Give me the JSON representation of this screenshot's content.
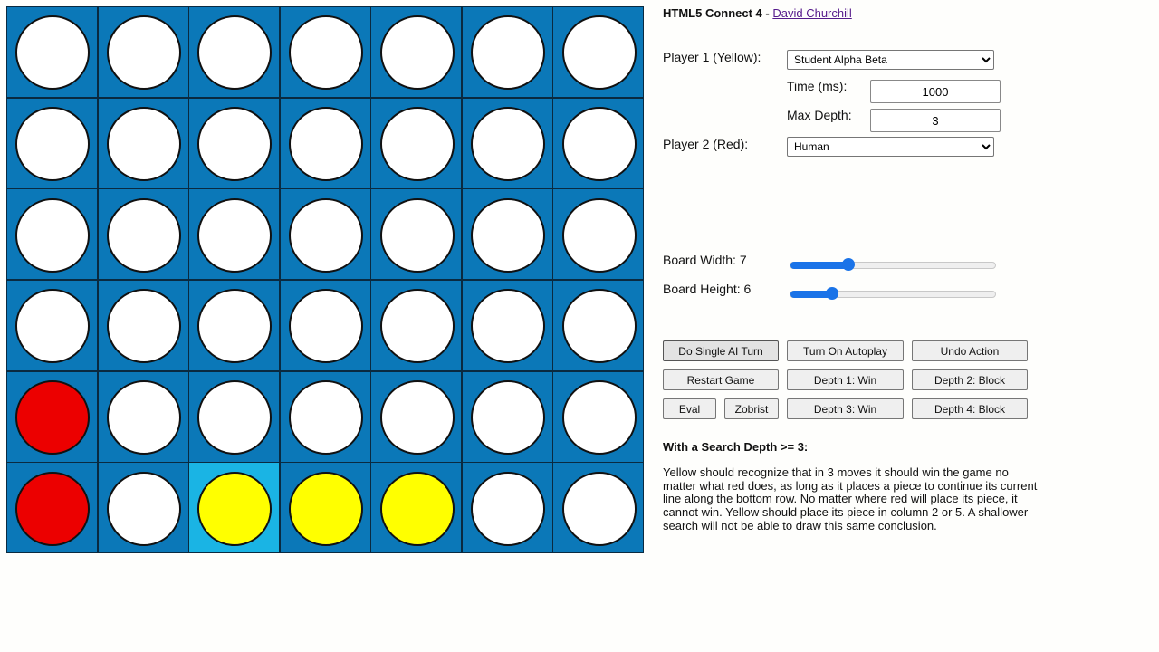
{
  "header": {
    "title": "HTML5 Connect 4",
    "separator": " - ",
    "author_link": "David Churchill"
  },
  "players": {
    "player1_label": "Player 1 (Yellow):",
    "player1_selected": "Student Alpha Beta",
    "time_label": "Time (ms):",
    "time_value": "1000",
    "depth_label": "Max Depth:",
    "depth_value": "3",
    "player2_label": "Player 2 (Red):",
    "player2_selected": "Human"
  },
  "board_settings": {
    "width_label": "Board Width: 7",
    "width_value": 7,
    "width_fraction": 0.28,
    "height_label": "Board Height: 6",
    "height_value": 6,
    "height_fraction": 0.2
  },
  "buttons": {
    "single_ai_turn": "Do Single AI Turn",
    "autoplay": "Turn On Autoplay",
    "undo": "Undo Action",
    "restart": "Restart Game",
    "depth1": "Depth 1: Win",
    "depth2": "Depth 2: Block",
    "eval": "Eval",
    "zobrist": "Zobrist",
    "depth3": "Depth 3: Win",
    "depth4": "Depth 4: Block"
  },
  "info": {
    "heading": "With a Search Depth >= 3:",
    "text": "Yellow should recognize that in 3 moves it should win the game no matter what red does, as long as it places a piece to continue its current line along the bottom row. No matter where red will place its piece, it cannot win. Yellow should place its piece in column 2 or 5. A shallower search will not be able to draw this same conclusion."
  },
  "board": {
    "columns": 7,
    "rows": 6,
    "highlight_cell": {
      "row": 5,
      "col": 2
    },
    "cells": [
      [
        "empty",
        "empty",
        "empty",
        "empty",
        "empty",
        "empty",
        "empty"
      ],
      [
        "empty",
        "empty",
        "empty",
        "empty",
        "empty",
        "empty",
        "empty"
      ],
      [
        "empty",
        "empty",
        "empty",
        "empty",
        "empty",
        "empty",
        "empty"
      ],
      [
        "empty",
        "empty",
        "empty",
        "empty",
        "empty",
        "empty",
        "empty"
      ],
      [
        "red",
        "empty",
        "empty",
        "empty",
        "empty",
        "empty",
        "empty"
      ],
      [
        "red",
        "empty",
        "yellow",
        "yellow",
        "yellow",
        "empty",
        "empty"
      ]
    ],
    "colors": {
      "board": "#0b78b8",
      "highlight": "#1ab4e4",
      "red": "#ec0000",
      "yellow": "#ffff00",
      "empty": "#ffffff"
    }
  }
}
